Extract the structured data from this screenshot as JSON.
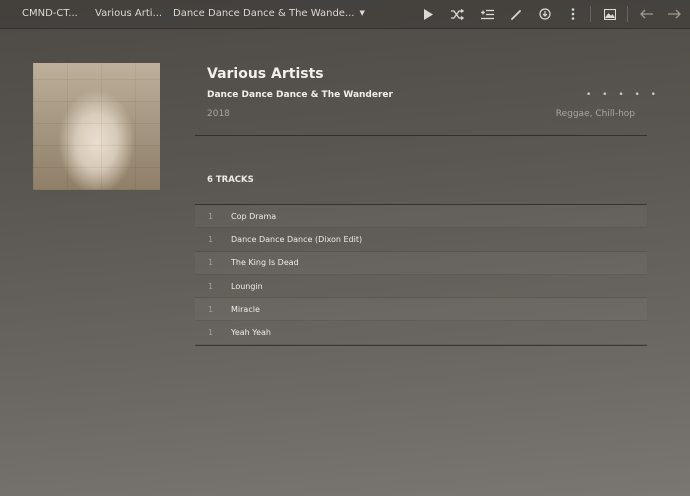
{
  "topbar": {
    "breadcrumbs": [
      {
        "label": "CMND-CT..."
      },
      {
        "label": "Various Arti..."
      },
      {
        "label": "Dance Dance Dance & The Wande..."
      }
    ],
    "icons": [
      "play-icon",
      "shuffle-icon",
      "add-to-queue-icon",
      "edit-icon",
      "download-icon",
      "more-vertical-icon",
      "image-icon",
      "back-arrow-icon",
      "forward-arrow-icon"
    ]
  },
  "album": {
    "artist": "Various Artists",
    "title": "Dance Dance Dance & The Wanderer",
    "year": "2018",
    "genres": "Reggae, Chill-hop",
    "rating_dots": "• • • • •",
    "rating": 0
  },
  "tracks_heading": "6 TRACKS",
  "tracks": [
    {
      "num": "1",
      "title": "Cop Drama"
    },
    {
      "num": "1",
      "title": "Dance Dance Dance (Dixon Edit)"
    },
    {
      "num": "1",
      "title": "The King Is Dead"
    },
    {
      "num": "1",
      "title": "Loungin"
    },
    {
      "num": "1",
      "title": "Miracle"
    },
    {
      "num": "1",
      "title": "Yeah Yeah"
    }
  ],
  "colors": {
    "text_primary": "#f2efea",
    "text_secondary": "#a9a59f",
    "background": "#5a5651"
  }
}
